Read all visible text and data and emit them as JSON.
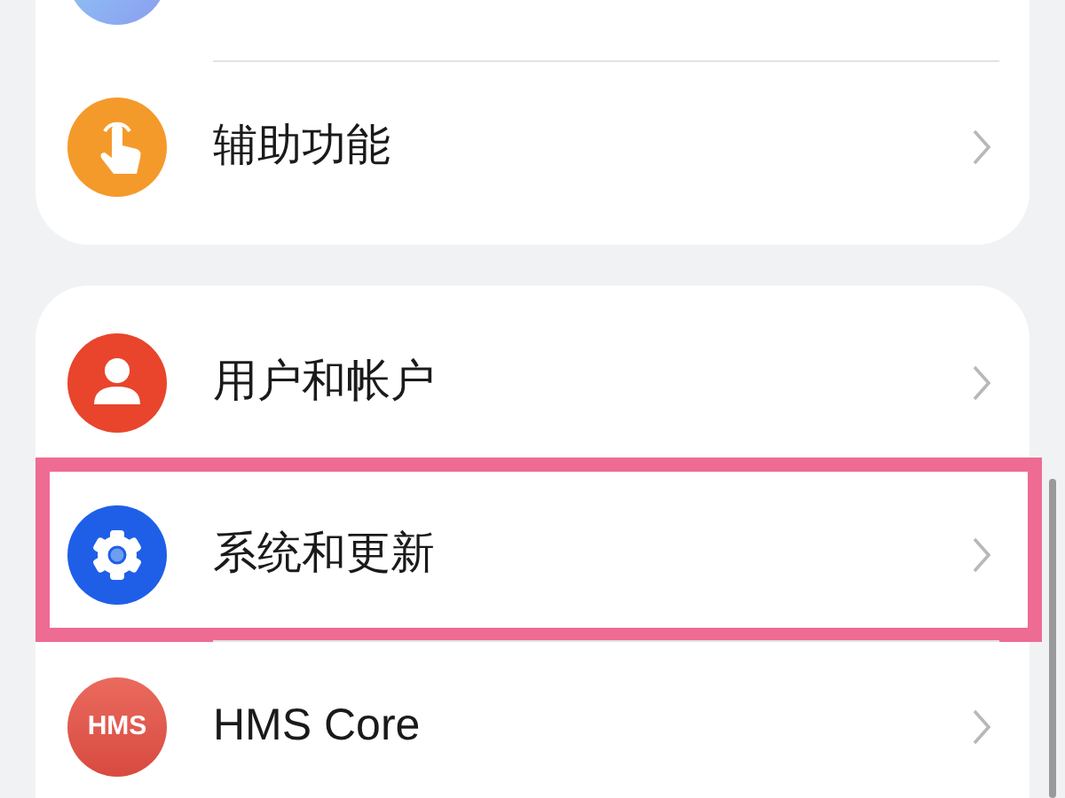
{
  "groups": [
    {
      "items": [
        {
          "kind": "gradient",
          "highlighted": false
        },
        {
          "kind": "hand",
          "label": "辅助功能",
          "highlighted": false
        }
      ]
    },
    {
      "items": [
        {
          "kind": "person",
          "label": "用户和帐户",
          "highlighted": false
        },
        {
          "kind": "gear",
          "label": "系统和更新",
          "highlighted": true
        },
        {
          "kind": "hms",
          "badge": "HMS",
          "label": "HMS Core",
          "highlighted": false
        }
      ]
    }
  ]
}
